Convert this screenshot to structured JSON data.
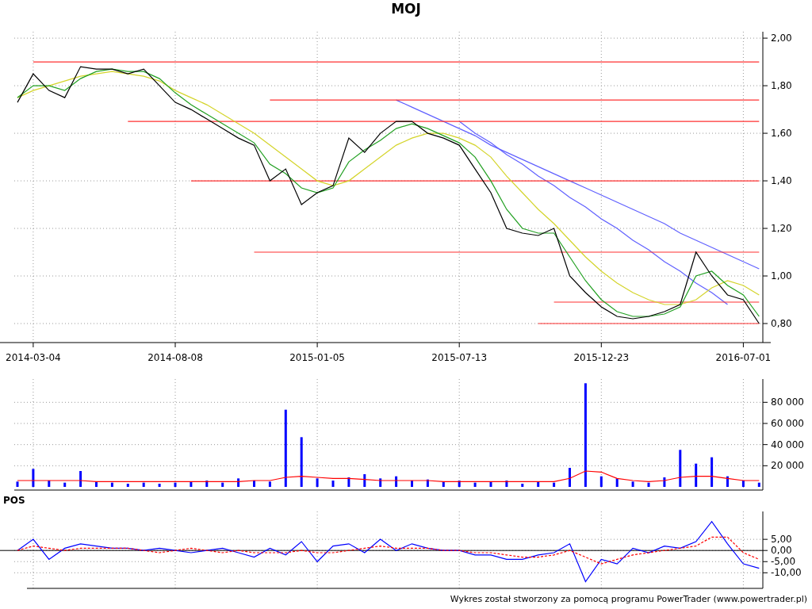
{
  "title": "MOJ",
  "price_panel": {
    "chart_data": {
      "type": "line",
      "grid": true,
      "categories": [
        null,
        "2014-03-04",
        null,
        null,
        null,
        null,
        null,
        null,
        null,
        null,
        "2014-08-08",
        null,
        null,
        null,
        null,
        null,
        null,
        null,
        null,
        "2015-01-05",
        null,
        null,
        null,
        null,
        null,
        null,
        null,
        null,
        "2015-07-13",
        null,
        null,
        null,
        null,
        null,
        null,
        null,
        null,
        "2015-12-23",
        null,
        null,
        null,
        null,
        null,
        null,
        null,
        null,
        "2016-07-01",
        null
      ],
      "ylim": [
        0.72,
        2.027
      ],
      "yticks": [
        {
          "value": 0.8,
          "label": "0,80"
        },
        {
          "value": 1.0,
          "label": "1,00"
        },
        {
          "value": 1.2,
          "label": "1,20"
        },
        {
          "value": 1.4,
          "label": "1,40"
        },
        {
          "value": 1.6,
          "label": "1,60"
        },
        {
          "value": 1.8,
          "label": "1,80"
        },
        {
          "value": 2.0,
          "label": "2,00"
        }
      ],
      "series": [
        {
          "color": "#000000",
          "values": [
            1.73,
            1.85,
            1.78,
            1.75,
            1.88,
            1.87,
            1.87,
            1.85,
            1.87,
            1.8,
            1.73,
            1.7,
            1.66,
            1.62,
            1.58,
            1.55,
            1.4,
            1.45,
            1.3,
            1.35,
            1.38,
            1.58,
            1.52,
            1.6,
            1.65,
            1.65,
            1.6,
            1.58,
            1.55,
            1.45,
            1.35,
            1.2,
            1.18,
            1.17,
            1.2,
            1.0,
            0.93,
            0.87,
            0.83,
            0.82,
            0.83,
            0.85,
            0.88,
            1.1,
            1.0,
            0.92,
            0.9,
            0.8
          ]
        },
        {
          "color": "#22a022",
          "values": [
            1.75,
            1.8,
            1.8,
            1.78,
            1.83,
            1.86,
            1.87,
            1.86,
            1.86,
            1.83,
            1.77,
            1.72,
            1.68,
            1.64,
            1.6,
            1.56,
            1.47,
            1.43,
            1.37,
            1.35,
            1.37,
            1.48,
            1.53,
            1.57,
            1.62,
            1.64,
            1.62,
            1.59,
            1.56,
            1.5,
            1.4,
            1.28,
            1.2,
            1.18,
            1.18,
            1.08,
            0.98,
            0.9,
            0.85,
            0.83,
            0.83,
            0.84,
            0.87,
            1.0,
            1.02,
            0.96,
            0.92,
            0.83
          ]
        },
        {
          "color": "#d4d42a",
          "values": [
            1.75,
            1.78,
            1.8,
            1.82,
            1.84,
            1.85,
            1.86,
            1.85,
            1.84,
            1.82,
            1.78,
            1.75,
            1.72,
            1.68,
            1.64,
            1.6,
            1.55,
            1.5,
            1.45,
            1.4,
            1.38,
            1.4,
            1.45,
            1.5,
            1.55,
            1.58,
            1.6,
            1.6,
            1.58,
            1.55,
            1.5,
            1.42,
            1.35,
            1.28,
            1.22,
            1.15,
            1.08,
            1.02,
            0.97,
            0.93,
            0.9,
            0.88,
            0.88,
            0.9,
            0.95,
            0.98,
            0.96,
            0.92
          ]
        },
        {
          "color": "#ff3030",
          "values": [
            null,
            1.9,
            1.9,
            1.9,
            1.9,
            1.9,
            1.9,
            1.9,
            1.9,
            1.9,
            1.9,
            1.9,
            1.9,
            1.9,
            1.9,
            1.9,
            1.9,
            1.9,
            1.9,
            1.9,
            1.9,
            1.9,
            1.9,
            1.9,
            1.9,
            1.9,
            1.9,
            1.9,
            1.9,
            1.9,
            1.9,
            1.9,
            1.9,
            1.9,
            1.9,
            1.9,
            1.9,
            1.9,
            1.9,
            1.9,
            1.9,
            1.9,
            1.9,
            1.9,
            1.9,
            1.9,
            1.9,
            1.9
          ]
        },
        {
          "color": "#ff3030",
          "values": [
            null,
            null,
            null,
            null,
            null,
            null,
            null,
            null,
            null,
            null,
            null,
            null,
            null,
            null,
            null,
            null,
            1.74,
            1.74,
            1.74,
            1.74,
            1.74,
            1.74,
            1.74,
            1.74,
            1.74,
            1.74,
            1.74,
            1.74,
            1.74,
            1.74,
            1.74,
            1.74,
            1.74,
            1.74,
            1.74,
            1.74,
            1.74,
            1.74,
            1.74,
            1.74,
            1.74,
            1.74,
            1.74,
            1.74,
            1.74,
            1.74,
            1.74,
            1.74
          ]
        },
        {
          "color": "#ff3030",
          "values": [
            null,
            null,
            null,
            null,
            null,
            null,
            null,
            1.65,
            1.65,
            1.65,
            1.65,
            1.65,
            1.65,
            1.65,
            1.65,
            1.65,
            1.65,
            1.65,
            1.65,
            1.65,
            1.65,
            1.65,
            1.65,
            1.65,
            1.65,
            1.65,
            1.65,
            1.65,
            1.65,
            1.65,
            1.65,
            1.65,
            1.65,
            1.65,
            1.65,
            1.65,
            1.65,
            1.65,
            1.65,
            1.65,
            1.65,
            1.65,
            1.65,
            1.65,
            1.65,
            1.65,
            1.65,
            1.65
          ]
        },
        {
          "color": "#ff3030",
          "values": [
            null,
            null,
            null,
            null,
            null,
            null,
            null,
            null,
            null,
            null,
            null,
            1.4,
            1.4,
            1.4,
            1.4,
            1.4,
            1.4,
            1.4,
            1.4,
            1.4,
            1.4,
            1.4,
            1.4,
            1.4,
            1.4,
            1.4,
            1.4,
            1.4,
            1.4,
            1.4,
            1.4,
            1.4,
            1.4,
            1.4,
            1.4,
            1.4,
            1.4,
            1.4,
            1.4,
            1.4,
            1.4,
            1.4,
            1.4,
            1.4,
            1.4,
            1.4,
            1.4,
            1.4
          ]
        },
        {
          "color": "#ff3030",
          "values": [
            null,
            null,
            null,
            null,
            null,
            null,
            null,
            null,
            null,
            null,
            null,
            null,
            null,
            null,
            null,
            1.1,
            1.1,
            1.1,
            1.1,
            1.1,
            1.1,
            1.1,
            1.1,
            1.1,
            1.1,
            1.1,
            1.1,
            1.1,
            1.1,
            1.1,
            1.1,
            1.1,
            1.1,
            1.1,
            1.1,
            1.1,
            1.1,
            1.1,
            1.1,
            1.1,
            1.1,
            1.1,
            1.1,
            1.1,
            1.1,
            1.1,
            1.1,
            1.1
          ]
        },
        {
          "color": "#ff3030",
          "values": [
            null,
            null,
            null,
            null,
            null,
            null,
            null,
            null,
            null,
            null,
            null,
            null,
            null,
            null,
            null,
            null,
            null,
            null,
            null,
            null,
            null,
            null,
            null,
            null,
            null,
            null,
            null,
            null,
            null,
            null,
            null,
            null,
            null,
            null,
            0.89,
            0.89,
            0.89,
            0.89,
            0.89,
            0.89,
            0.89,
            0.89,
            0.89,
            0.89,
            0.89,
            0.89,
            0.89,
            0.89
          ]
        },
        {
          "color": "#ff3030",
          "values": [
            null,
            null,
            null,
            null,
            null,
            null,
            null,
            null,
            null,
            null,
            null,
            null,
            null,
            null,
            null,
            null,
            null,
            null,
            null,
            null,
            null,
            null,
            null,
            null,
            null,
            null,
            null,
            null,
            null,
            null,
            null,
            null,
            null,
            0.8,
            0.8,
            0.8,
            0.8,
            0.8,
            0.8,
            0.8,
            0.8,
            0.8,
            0.8,
            0.8,
            0.8,
            0.8,
            0.8,
            0.8
          ]
        },
        {
          "color": "#6060ff",
          "values": [
            null,
            null,
            null,
            null,
            null,
            null,
            null,
            null,
            null,
            null,
            null,
            null,
            null,
            null,
            null,
            null,
            null,
            null,
            null,
            null,
            null,
            null,
            null,
            null,
            1.74,
            1.71,
            1.68,
            1.65,
            1.62,
            1.59,
            1.55,
            1.52,
            1.49,
            1.46,
            1.43,
            1.4,
            1.37,
            1.34,
            1.31,
            1.28,
            1.25,
            1.22,
            1.18,
            1.15,
            1.12,
            1.09,
            1.06,
            1.03
          ]
        },
        {
          "color": "#6060ff",
          "values": [
            null,
            null,
            null,
            null,
            null,
            null,
            null,
            null,
            null,
            null,
            null,
            null,
            null,
            null,
            null,
            null,
            null,
            null,
            null,
            null,
            null,
            null,
            null,
            null,
            null,
            null,
            null,
            null,
            1.65,
            1.6,
            1.56,
            1.51,
            1.47,
            1.42,
            1.38,
            1.33,
            1.29,
            1.24,
            1.2,
            1.15,
            1.11,
            1.06,
            1.02,
            0.97,
            0.93,
            0.88,
            null,
            null
          ]
        }
      ]
    }
  },
  "volume_panel": {
    "chart_data": {
      "type": "bar",
      "grid": true,
      "ylim": [
        0,
        102000
      ],
      "yticks": [
        {
          "value": 20000,
          "label": "20 000"
        },
        {
          "value": 40000,
          "label": "40 000"
        },
        {
          "value": 60000,
          "label": "60 000"
        },
        {
          "value": 80000,
          "label": "80 000"
        }
      ],
      "series": [
        {
          "type": "bar",
          "color": "#0000ff",
          "values": [
            5000,
            17000,
            6000,
            4000,
            15000,
            5000,
            4000,
            3000,
            4000,
            3000,
            4000,
            5000,
            6000,
            4000,
            8000,
            6000,
            5000,
            73000,
            47000,
            8000,
            6000,
            9000,
            12000,
            8000,
            10000,
            6000,
            7000,
            5000,
            6000,
            4000,
            5000,
            6000,
            3000,
            5000,
            4000,
            18000,
            98000,
            10000,
            8000,
            5000,
            4000,
            9000,
            35000,
            22000,
            28000,
            10000,
            6000,
            4000
          ]
        },
        {
          "type": "line",
          "color": "#ff0000",
          "values": [
            6000,
            6000,
            6000,
            6000,
            6000,
            5000,
            5000,
            5000,
            5000,
            5000,
            5000,
            5000,
            5000,
            5000,
            5000,
            6000,
            6000,
            9000,
            10000,
            9000,
            8000,
            8000,
            7000,
            6000,
            6000,
            6000,
            6000,
            5000,
            5000,
            5000,
            5000,
            5000,
            5000,
            5000,
            5000,
            8000,
            15000,
            14000,
            8000,
            6000,
            5000,
            6000,
            9000,
            10000,
            10000,
            8000,
            6000,
            6000
          ]
        }
      ]
    }
  },
  "pos_panel": {
    "label": "POS",
    "chart_data": {
      "type": "line",
      "grid": true,
      "ylim": [
        -17,
        17.5
      ],
      "yticks": [
        {
          "value": 5,
          "label": "5,00"
        },
        {
          "value": 0,
          "label": "0,00"
        },
        {
          "value": -5,
          "label": "-5,00"
        },
        {
          "value": -10,
          "label": "-10,00"
        }
      ],
      "series": [
        {
          "color": "#0000ff",
          "line_style": "solid",
          "values": [
            0,
            5,
            -4,
            1,
            3,
            2,
            1,
            1,
            0,
            1,
            0,
            -1,
            0,
            1,
            -1,
            -3,
            1,
            -2,
            4,
            -5,
            2,
            3,
            -1,
            5,
            0,
            3,
            1,
            0,
            0,
            -2,
            -2,
            -4,
            -4,
            -2,
            -1,
            3,
            -14,
            -4,
            -6,
            1,
            -1,
            2,
            1,
            4,
            13,
            3,
            -6,
            -8
          ]
        },
        {
          "color": "#ff0000",
          "line_style": "dashed",
          "values": [
            0,
            2,
            1,
            0,
            1,
            1,
            1,
            1,
            0,
            -1,
            0,
            1,
            0,
            -1,
            0,
            -1,
            -1,
            -1,
            0,
            -1,
            -1,
            0,
            1,
            2,
            1,
            1,
            1,
            0,
            0,
            -1,
            -1,
            -2,
            -3,
            -3,
            -2,
            0,
            -3,
            -6,
            -4,
            -2,
            -1,
            0,
            1,
            2,
            6,
            6,
            -1,
            -4
          ]
        }
      ]
    }
  },
  "footer": "Wykres został stworzony za pomocą programu PowerTrader (www.powertrader.pl)"
}
